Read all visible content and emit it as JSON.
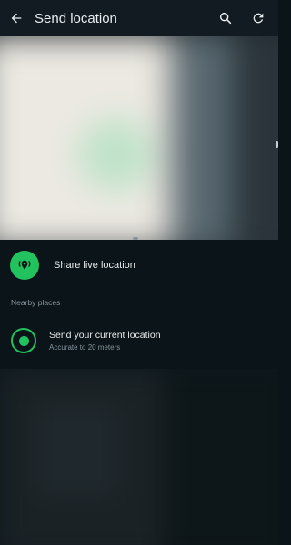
{
  "header": {
    "title": "Send location",
    "back_icon": "arrow-left-icon",
    "search_icon": "search-icon",
    "refresh_icon": "refresh-icon"
  },
  "live_location": {
    "label": "Share live location",
    "icon": "live-location-icon"
  },
  "nearby": {
    "header": "Nearby places",
    "current_location": {
      "title": "Send your current location",
      "subtitle": "Accurate to 20 meters",
      "icon": "current-location-icon"
    }
  },
  "colors": {
    "accent": "#22c25f",
    "background": "#0b1418",
    "app_bar": "#111b21",
    "primary_text": "#e9edef",
    "secondary_text": "#8696a0"
  }
}
